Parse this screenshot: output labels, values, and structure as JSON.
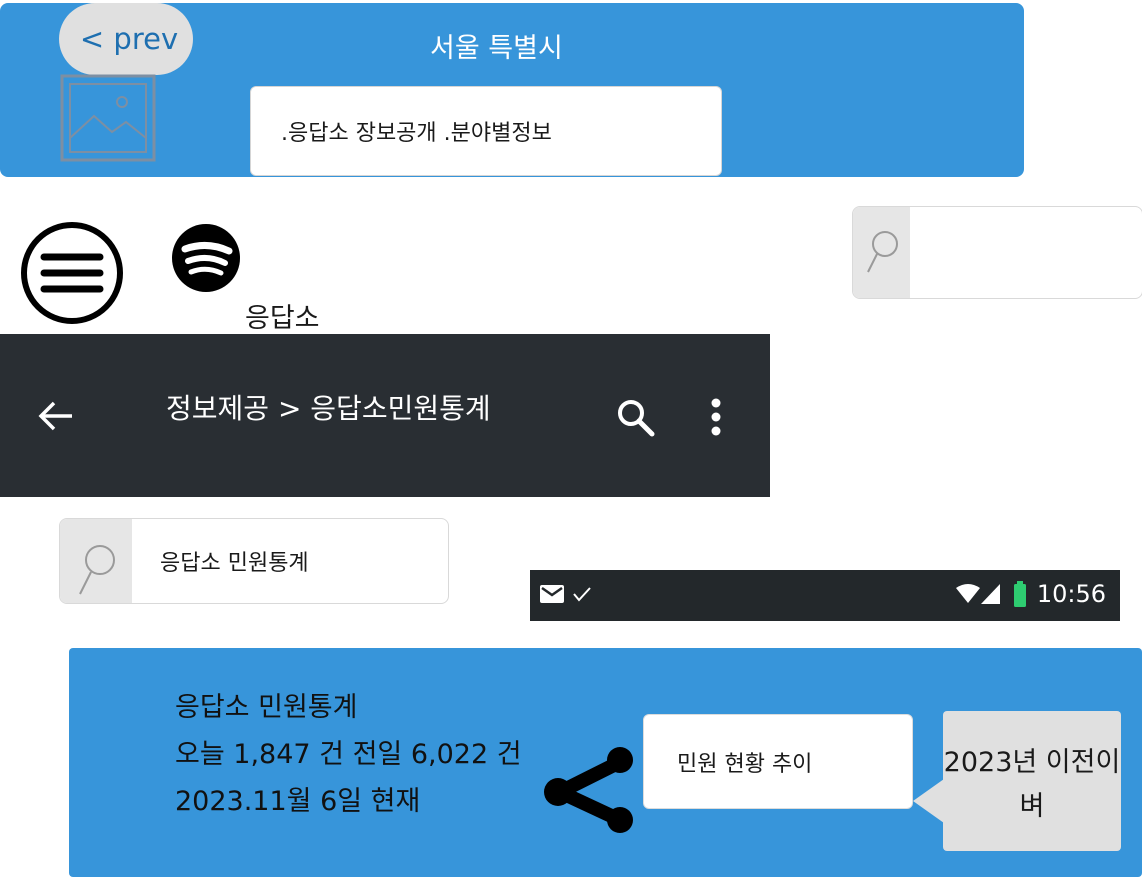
{
  "header": {
    "prev_label": "< prev",
    "title": "서울 특별시",
    "subtitle_box": ".응답소  장보공개 .분야별정보"
  },
  "icons": {
    "menu": "menu-circle-icon",
    "spotify": "spotify-icon",
    "image_placeholder": "image-icon",
    "search": "search-icon",
    "back": "arrow-left-icon",
    "more": "more-vert-icon",
    "share": "share-icon"
  },
  "spotify_label": "응답소",
  "appbar": {
    "title": "정보제공 > 응답소민원통계"
  },
  "search_mid": {
    "value": "응답소 민원통계"
  },
  "statusbar": {
    "time": "10:56",
    "battery_color": "#2ecc71"
  },
  "stats": {
    "line1": "응답소 민원통계",
    "line2": "오늘 1,847 건 전일 6,022 건",
    "line3": "2023.11월 6일 현재"
  },
  "trend_button": "민원 현황 추이",
  "tooltip": "2023년 이전이 벼",
  "colors": {
    "header_blue": "#3795da",
    "appbar_dark": "#292e33",
    "statusbar_dark": "#23282b"
  }
}
